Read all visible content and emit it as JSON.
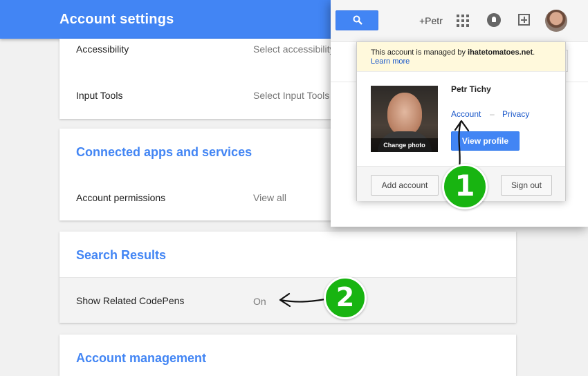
{
  "header": {
    "title": "Account settings"
  },
  "settings": {
    "accessibility": {
      "label": "Accessibility",
      "value": "Select accessibility"
    },
    "input_tools": {
      "label": "Input Tools",
      "value": "Select Input Tools"
    },
    "connected": {
      "title": "Connected apps and services",
      "permissions_label": "Account permissions",
      "permissions_value": "View all"
    },
    "search_results": {
      "title": "Search Results",
      "related_label": "Show Related CodePens",
      "related_value": "On"
    },
    "account_management": {
      "title": "Account management"
    }
  },
  "gbar": {
    "user_link": "+Petr",
    "icons": [
      "search-icon",
      "apps-grid-icon",
      "notifications-bell-icon",
      "share-plus-icon",
      "avatar"
    ]
  },
  "account_popup": {
    "notice_prefix": "This account is managed by",
    "notice_domain": "ihatetomatoes.net",
    "notice_suffix": ".",
    "learn_more": "Learn more",
    "photo_caption": "Change photo",
    "name": "Petr Tichy",
    "account_link": "Account",
    "separator": "–",
    "privacy_link": "Privacy",
    "view_profile": "View profile",
    "add_account": "Add account",
    "sign_out": "Sign out"
  },
  "annotations": {
    "marker_1": "1",
    "marker_2": "2"
  },
  "colors": {
    "accent": "#4285f4",
    "badge": "#18b411",
    "notice_bg": "#fff9dc",
    "link": "#1a57c9"
  }
}
